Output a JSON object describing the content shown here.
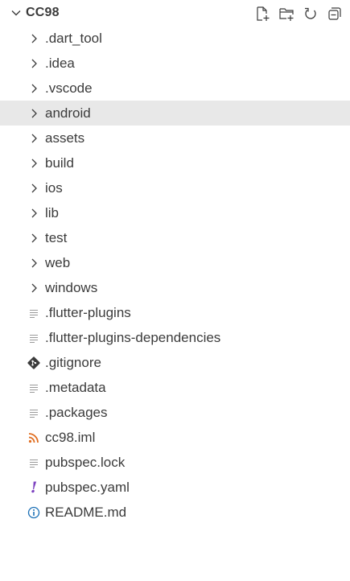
{
  "explorer": {
    "title": "CC98",
    "actions": [
      {
        "name": "new-file-icon"
      },
      {
        "name": "new-folder-icon"
      },
      {
        "name": "refresh-icon"
      },
      {
        "name": "collapse-all-icon"
      }
    ]
  },
  "tree": {
    "folders": [
      {
        "label": ".dart_tool",
        "icon": "chevron-right-icon"
      },
      {
        "label": ".idea",
        "icon": "chevron-right-icon"
      },
      {
        "label": ".vscode",
        "icon": "chevron-right-icon"
      },
      {
        "label": "android",
        "icon": "chevron-right-icon"
      },
      {
        "label": "assets",
        "icon": "chevron-right-icon"
      },
      {
        "label": "build",
        "icon": "chevron-right-icon"
      },
      {
        "label": "ios",
        "icon": "chevron-right-icon"
      },
      {
        "label": "lib",
        "icon": "chevron-right-icon"
      },
      {
        "label": "test",
        "icon": "chevron-right-icon"
      },
      {
        "label": "web",
        "icon": "chevron-right-icon"
      },
      {
        "label": "windows",
        "icon": "chevron-right-icon"
      }
    ],
    "files": [
      {
        "label": ".flutter-plugins",
        "icon": "text-file-icon"
      },
      {
        "label": ".flutter-plugins-dependencies",
        "icon": "text-file-icon"
      },
      {
        "label": ".gitignore",
        "icon": "git-icon"
      },
      {
        "label": ".metadata",
        "icon": "text-file-icon"
      },
      {
        "label": ".packages",
        "icon": "text-file-icon"
      },
      {
        "label": "cc98.iml",
        "icon": "rss-icon"
      },
      {
        "label": "pubspec.lock",
        "icon": "text-file-icon"
      },
      {
        "label": "pubspec.yaml",
        "icon": "yaml-exclamation-icon",
        "glyph": "!"
      },
      {
        "label": "README.md",
        "icon": "info-icon"
      }
    ]
  },
  "colors": {
    "hover_row": "#e8e8e8",
    "git_icon": "#3b3b3b",
    "rss_icon": "#e06c1e",
    "yaml_icon": "#7b3fbf",
    "info_icon": "#1a6fb5",
    "text_file_icon": "#9a9a9a"
  }
}
